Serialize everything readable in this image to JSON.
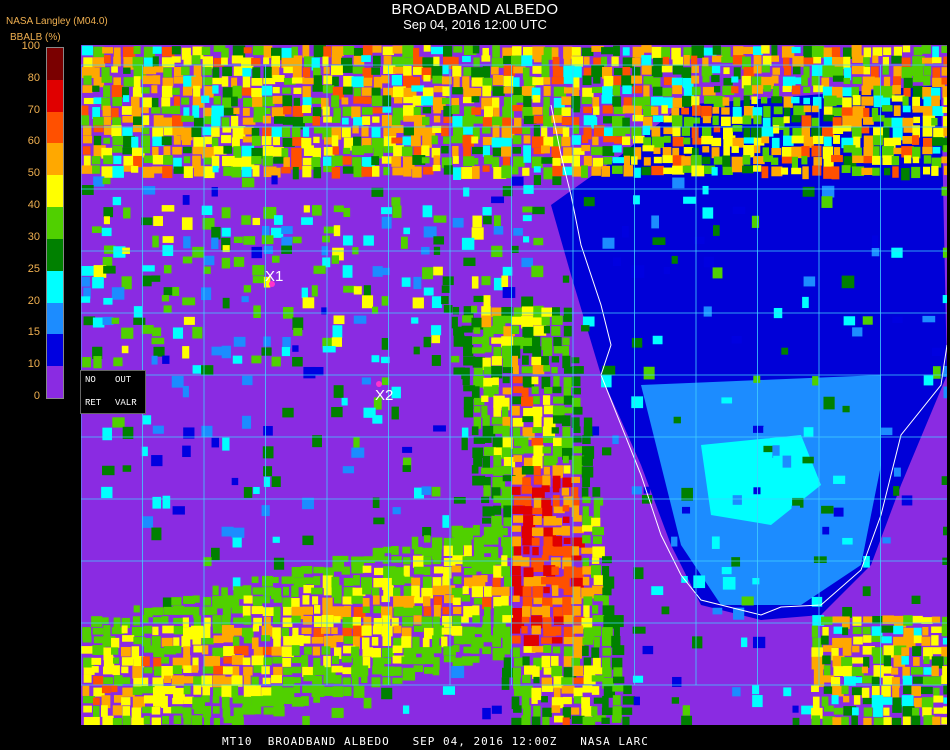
{
  "header": {
    "title": "BROADBAND ALBEDO",
    "subtitle": "Sep 04, 2016 12:00 UTC",
    "source": "NASA Langley (M04.0)"
  },
  "colorbar": {
    "title": "BBALB (%)",
    "ticks": [
      "100",
      "80",
      "70",
      "60",
      "50",
      "40",
      "30",
      "25",
      "20",
      "15",
      "10",
      "0"
    ],
    "segments": [
      {
        "from": 80,
        "to": 100,
        "color": "#7a0000"
      },
      {
        "from": 70,
        "to": 80,
        "color": "#e00000"
      },
      {
        "from": 60,
        "to": 70,
        "color": "#ff5000"
      },
      {
        "from": 50,
        "to": 60,
        "color": "#ffa800"
      },
      {
        "from": 40,
        "to": 50,
        "color": "#ffff00"
      },
      {
        "from": 30,
        "to": 40,
        "color": "#50d000"
      },
      {
        "from": 25,
        "to": 30,
        "color": "#008000"
      },
      {
        "from": 20,
        "to": 25,
        "color": "#00ffff"
      },
      {
        "from": 15,
        "to": 20,
        "color": "#1c8cff"
      },
      {
        "from": 10,
        "to": 15,
        "color": "#0000e0"
      },
      {
        "from": 0,
        "to": 10,
        "color": "#8a2be2"
      }
    ]
  },
  "legend_box": {
    "no": "NO",
    "out": "OUT",
    "ret": "RET",
    "valr": "VALR"
  },
  "markers": [
    {
      "label": "X1"
    },
    {
      "label": "X2"
    }
  ],
  "footer": "MT10  BROADBAND ALBEDO   SEP 04, 2016 12:00Z   NASA LARC",
  "colors": {
    "ocean": "#8a2be2",
    "grid": "#40d0ff",
    "coast": "#ffffff",
    "marker": "#ff33cc"
  }
}
